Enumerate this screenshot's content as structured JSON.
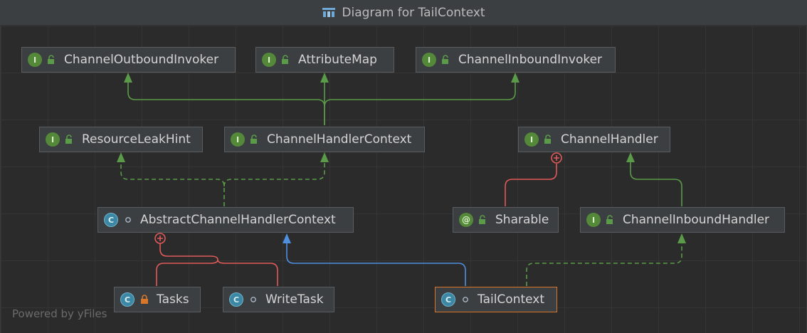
{
  "window": {
    "title": "Diagram for TailContext",
    "footer": "Powered by yFiles"
  },
  "colors": {
    "background": "#2b2b2b",
    "node_fill": "#3c3f41",
    "node_border": "#5a5d5f",
    "selected_border": "#d8772a",
    "interface_badge": "#55893a",
    "class_badge": "#3c87a4",
    "extends_edge": "#4f8fe0",
    "implements_edge": "#5a9a48",
    "inner_edge": "#e05a5a"
  },
  "nodes": [
    {
      "id": "ChannelOutboundInvoker",
      "label": "ChannelOutboundInvoker",
      "kind": "interface",
      "access": "public"
    },
    {
      "id": "AttributeMap",
      "label": "AttributeMap",
      "kind": "interface",
      "access": "public"
    },
    {
      "id": "ChannelInboundInvoker",
      "label": "ChannelInboundInvoker",
      "kind": "interface",
      "access": "public"
    },
    {
      "id": "ResourceLeakHint",
      "label": "ResourceLeakHint",
      "kind": "interface",
      "access": "public"
    },
    {
      "id": "ChannelHandlerContext",
      "label": "ChannelHandlerContext",
      "kind": "interface",
      "access": "public"
    },
    {
      "id": "ChannelHandler",
      "label": "ChannelHandler",
      "kind": "interface",
      "access": "public"
    },
    {
      "id": "AbstractChannelHandlerContext",
      "label": "AbstractChannelHandlerContext",
      "kind": "abstract-class",
      "access": "package"
    },
    {
      "id": "Sharable",
      "label": "Sharable",
      "kind": "annotation",
      "access": "public"
    },
    {
      "id": "ChannelInboundHandler",
      "label": "ChannelInboundHandler",
      "kind": "interface",
      "access": "public"
    },
    {
      "id": "Tasks",
      "label": "Tasks",
      "kind": "class",
      "access": "private"
    },
    {
      "id": "WriteTask",
      "label": "WriteTask",
      "kind": "class",
      "access": "package"
    },
    {
      "id": "TailContext",
      "label": "TailContext",
      "kind": "class",
      "access": "package",
      "selected": true
    }
  ],
  "edges": [
    {
      "from": "ChannelHandlerContext",
      "to": "ChannelOutboundInvoker",
      "type": "interface-extends"
    },
    {
      "from": "ChannelHandlerContext",
      "to": "AttributeMap",
      "type": "interface-extends"
    },
    {
      "from": "ChannelHandlerContext",
      "to": "ChannelInboundInvoker",
      "type": "interface-extends"
    },
    {
      "from": "AbstractChannelHandlerContext",
      "to": "ResourceLeakHint",
      "type": "implements"
    },
    {
      "from": "AbstractChannelHandlerContext",
      "to": "ChannelHandlerContext",
      "type": "implements"
    },
    {
      "from": "Sharable",
      "to": "ChannelHandler",
      "type": "inner"
    },
    {
      "from": "ChannelInboundHandler",
      "to": "ChannelHandler",
      "type": "interface-extends"
    },
    {
      "from": "Tasks",
      "to": "AbstractChannelHandlerContext",
      "type": "inner"
    },
    {
      "from": "WriteTask",
      "to": "AbstractChannelHandlerContext",
      "type": "inner"
    },
    {
      "from": "TailContext",
      "to": "AbstractChannelHandlerContext",
      "type": "extends"
    },
    {
      "from": "TailContext",
      "to": "ChannelInboundHandler",
      "type": "implements"
    }
  ]
}
